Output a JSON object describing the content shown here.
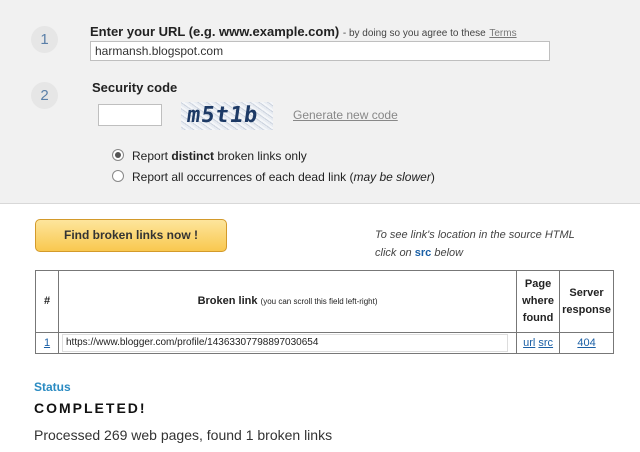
{
  "form": {
    "step1": {
      "number": "1",
      "label": "Enter your URL (e.g. www.example.com)",
      "note": "- by doing so you agree to these",
      "terms_link": "Terms",
      "url_value": "harmansh.blogspot.com"
    },
    "step2": {
      "number": "2",
      "label": "Security code",
      "code_value": "",
      "captcha_text": "m5t1b",
      "generate_link": "Generate new code"
    },
    "options": [
      {
        "selected": true,
        "pre": "Report ",
        "bold": "distinct",
        "post": " broken links only",
        "extra": ""
      },
      {
        "selected": false,
        "pre": "Report all occurrences of each dead link (",
        "bold": "",
        "post": "",
        "extra": "may be slower"
      }
    ]
  },
  "actions": {
    "find_button": "Find broken links now !",
    "hint_line1": "To see link's location in the source HTML",
    "hint_pre": "click on ",
    "hint_src": "src",
    "hint_post": " below"
  },
  "results": {
    "headers": {
      "num": "#",
      "broken_link": "Broken link",
      "broken_link_note": "(you can scroll this field left-right)",
      "page_line1": "Page",
      "page_line2": "where",
      "page_line3": "found",
      "server_line1": "Server",
      "server_line2": "response"
    },
    "rows": [
      {
        "num": "1",
        "link": "https://www.blogger.com/profile/14363307798897030654",
        "url_label": "url",
        "src_label": "src",
        "response": "404"
      }
    ]
  },
  "status": {
    "label": "Status",
    "value": "COMPLETED!",
    "summary": "Processed 269 web pages, found 1 broken links"
  }
}
